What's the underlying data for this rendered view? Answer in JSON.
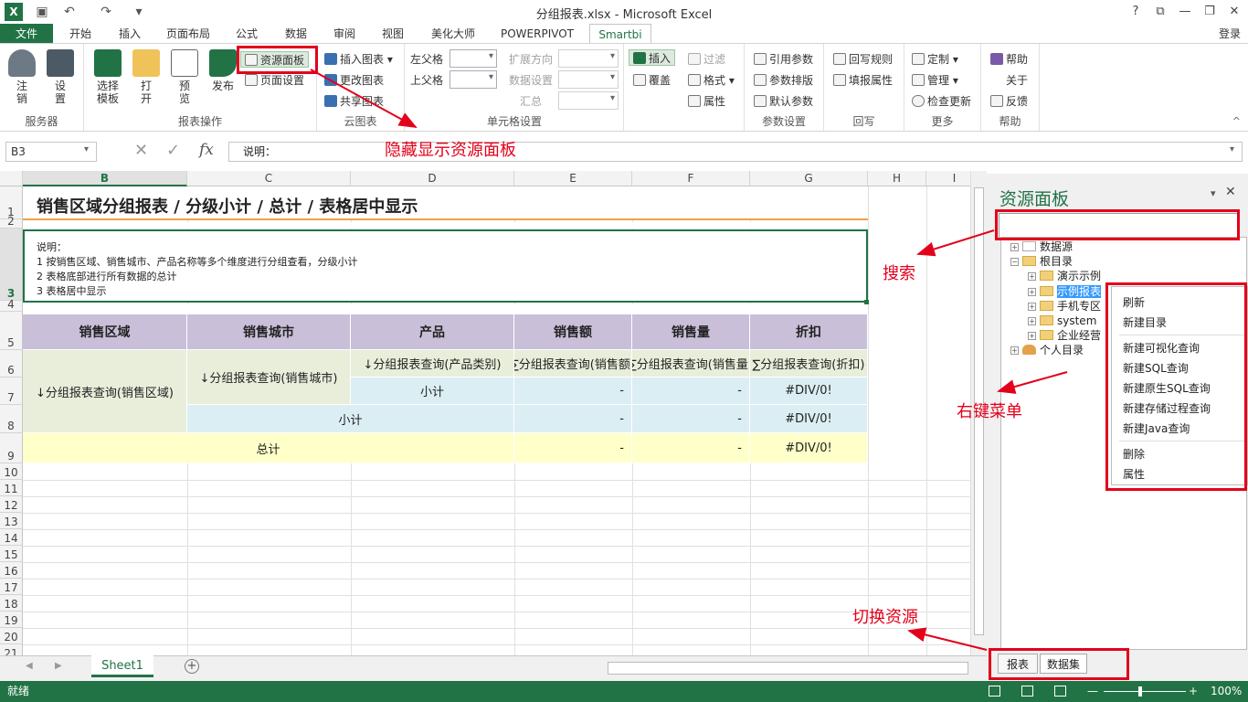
{
  "window": {
    "title": "分组报表.xlsx - Microsoft Excel",
    "controls": [
      "?",
      "⧉",
      "—",
      "❐",
      "✕"
    ]
  },
  "menu": {
    "file": "文件",
    "tabs": [
      "开始",
      "插入",
      "页面布局",
      "公式",
      "数据",
      "审阅",
      "视图",
      "美化大师",
      "POWERPIVOT",
      "Smartbi"
    ],
    "login": "登录"
  },
  "ribbon": {
    "server": {
      "label": "服务器",
      "login": "注\n销",
      "settings": "设\n置"
    },
    "report_ops": {
      "label": "报表操作",
      "select_template": "选择\n模板",
      "open": "打\n开",
      "preview": "预\n览",
      "publish": "发布",
      "resource_panel": "资源面板",
      "page_setup": "页面设置"
    },
    "cloud_chart": {
      "label": "云图表",
      "insert_chart": "插入图表",
      "change_chart": "更改图表",
      "share_chart": "共享图表"
    },
    "cell_settings": {
      "label": "单元格设置",
      "left_parent": "左父格",
      "top_parent": "上父格",
      "expand_dir": "扩展方向",
      "data_settings": "数据设置",
      "summary": "汇总"
    },
    "insert": {
      "insert": "插入",
      "overlay": "覆盖",
      "filter": "过滤",
      "format": "格式",
      "property": "属性"
    },
    "params": {
      "label": "参数设置",
      "ref_param": "引用参数",
      "param_layout": "参数排版",
      "default_param": "默认参数"
    },
    "writeback": {
      "label": "回写",
      "rule": "回写规则",
      "fill_attr": "填报属性"
    },
    "more": {
      "label": "更多",
      "custom": "定制",
      "manage": "管理",
      "check_update": "检查更新"
    },
    "help": {
      "label": "帮助",
      "help": "帮助",
      "about": "关于",
      "feedback": "反馈"
    }
  },
  "formula_bar": {
    "name_box": "B3",
    "content": "说明："
  },
  "grid": {
    "columns": [
      "B",
      "C",
      "D",
      "E",
      "F",
      "G",
      "H",
      "I"
    ],
    "rows": [
      "1",
      "2",
      "3",
      "4",
      "5",
      "6",
      "7",
      "8",
      "9",
      "10",
      "11",
      "12",
      "13",
      "14",
      "15",
      "16",
      "17",
      "18",
      "19",
      "20",
      "21"
    ],
    "title": "销售区域分组报表 / 分级小计 / 总计 / 表格居中显示",
    "desc": [
      "说明：",
      "1 按销售区域、销售城市、产品名称等多个维度进行分组查看，分级小计",
      "2 表格底部进行所有数据的总计",
      "3 表格居中显示"
    ],
    "headers": [
      "销售区域",
      "销售城市",
      "产品",
      "销售额",
      "销售量",
      "折扣"
    ],
    "r6": [
      "↓分组报表查询(产品类别)",
      "∑分组报表查询(销售额)",
      "∑分组报表查询(销售量)",
      "∑分组报表查询(折扣)"
    ],
    "region_cell": "↓分组报表查询(销售区域)",
    "city_cell": "↓分组报表查询(销售城市)",
    "subtotal": "小计",
    "total": "总计",
    "dash": "-",
    "div0": "#DIV/0!"
  },
  "sheet_tabs": {
    "active": "Sheet1",
    "add": "+"
  },
  "status": {
    "ready": "就绪",
    "zoom": "100%"
  },
  "panel": {
    "title": "资源面板",
    "tree": [
      "数据源",
      "根目录",
      "演示示例",
      "示例报表",
      "手机专区",
      "system",
      "企业经营",
      "个人目录"
    ],
    "tabs": [
      "报表",
      "数据集"
    ]
  },
  "context_menu": [
    "刷新",
    "新建目录",
    "新建可视化查询",
    "新建SQL查询",
    "新建原生SQL查询",
    "新建存储过程查询",
    "新建Java查询",
    "删除",
    "属性"
  ],
  "annotations": {
    "toggle": "隐藏显示资源面板",
    "search": "搜索",
    "context": "右键菜单",
    "switch": "切换资源"
  },
  "colors": {
    "excel_green": "#217346",
    "annotation_red": "#e3001b",
    "header_purple": "#c9bfd9"
  }
}
